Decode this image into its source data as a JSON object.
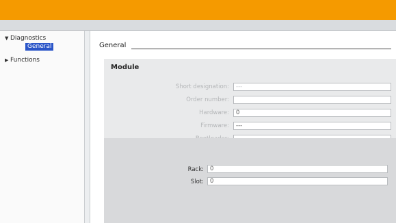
{
  "sidebar": {
    "items": [
      {
        "label": "Diagnostics",
        "arrow": "▼"
      },
      {
        "label": "General"
      },
      {
        "label": "Functions",
        "arrow": "▶"
      }
    ]
  },
  "content": {
    "section_title": "General",
    "module": {
      "title": "Module",
      "fields": [
        {
          "label": "Short designation:",
          "value": "---"
        },
        {
          "label": "Order number:",
          "value": ""
        },
        {
          "label": "Hardware:",
          "value": "0"
        },
        {
          "label": "Firmware:",
          "value": "---"
        },
        {
          "label": "Bootloader:",
          "value": ""
        }
      ],
      "location": [
        {
          "label": "Rack:",
          "value": "0"
        },
        {
          "label": "Slot:",
          "value": "0"
        }
      ]
    }
  },
  "colors": {
    "titlebar": "#f59a00",
    "selection": "#2a55c8"
  }
}
